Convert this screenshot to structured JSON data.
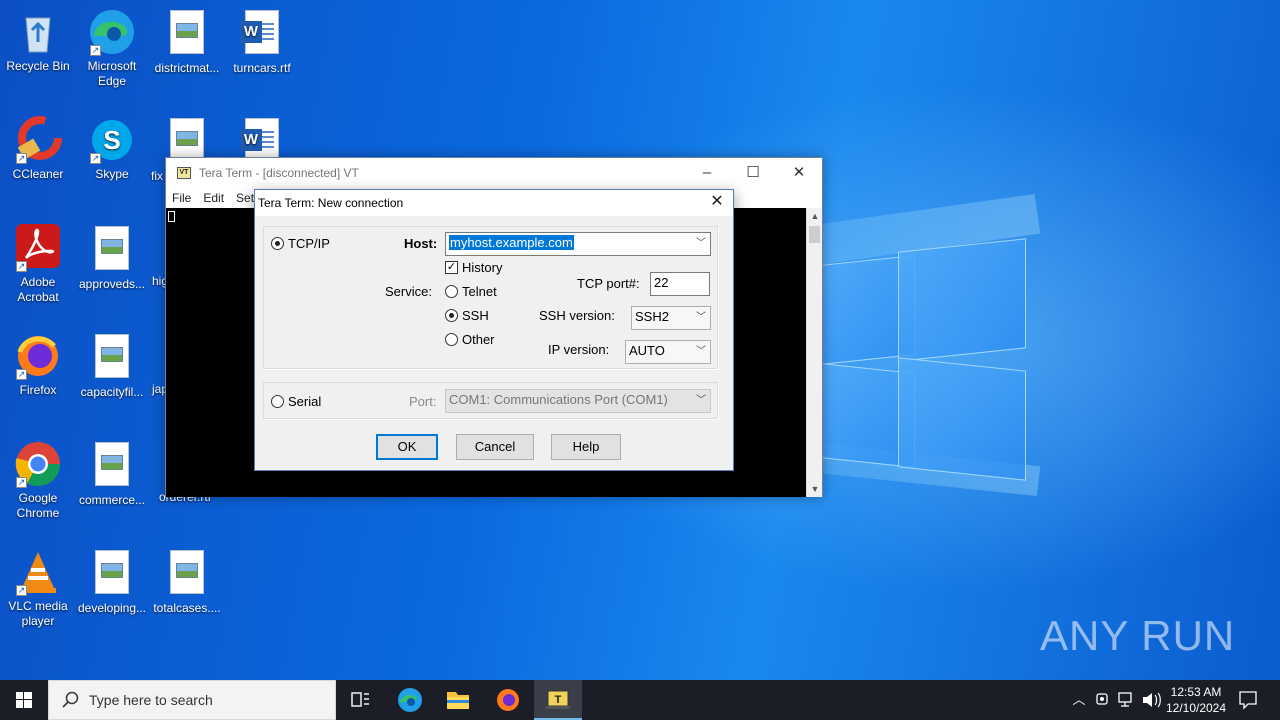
{
  "desktop": {
    "icons": [
      {
        "label": "Recycle Bin"
      },
      {
        "label": "Microsoft Edge"
      },
      {
        "label": "districtmat..."
      },
      {
        "label": "turncars.rtf"
      },
      {
        "label": "CCleaner"
      },
      {
        "label": "Skype"
      },
      {
        "label": "fix"
      },
      {
        "label": "Adobe Acrobat"
      },
      {
        "label": "approveds..."
      },
      {
        "label": "hig"
      },
      {
        "label": "Firefox"
      },
      {
        "label": "capacityfil..."
      },
      {
        "label": "jap"
      },
      {
        "label": "Google Chrome"
      },
      {
        "label": "commerce..."
      },
      {
        "label": "orderer.rtf"
      },
      {
        "label": "VLC media player"
      },
      {
        "label": "developing..."
      },
      {
        "label": "totalcases...."
      }
    ],
    "watermark": "ANY RUN"
  },
  "teraterm": {
    "title": "Tera Term - [disconnected] VT",
    "menu": [
      "File",
      "Edit",
      "Set"
    ]
  },
  "dialog": {
    "title": "Tera Term: New connection",
    "tcpip_label": "TCP/IP",
    "host_label": "Host:",
    "host_value": "myhost.example.com",
    "history_label": "History",
    "service_label": "Service:",
    "telnet_label": "Telnet",
    "ssh_label": "SSH",
    "other_label": "Other",
    "tcp_port_label": "TCP port#:",
    "tcp_port_value": "22",
    "ssh_version_label": "SSH version:",
    "ssh_version_value": "SSH2",
    "ip_version_label": "IP version:",
    "ip_version_value": "AUTO",
    "serial_label": "Serial",
    "port_label": "Port:",
    "port_value": "COM1: Communications Port (COM1)",
    "ok_label": "OK",
    "cancel_label": "Cancel",
    "help_label": "Help"
  },
  "taskbar": {
    "search_placeholder": "Type here to search",
    "time": "12:53 AM",
    "date": "12/10/2024"
  }
}
